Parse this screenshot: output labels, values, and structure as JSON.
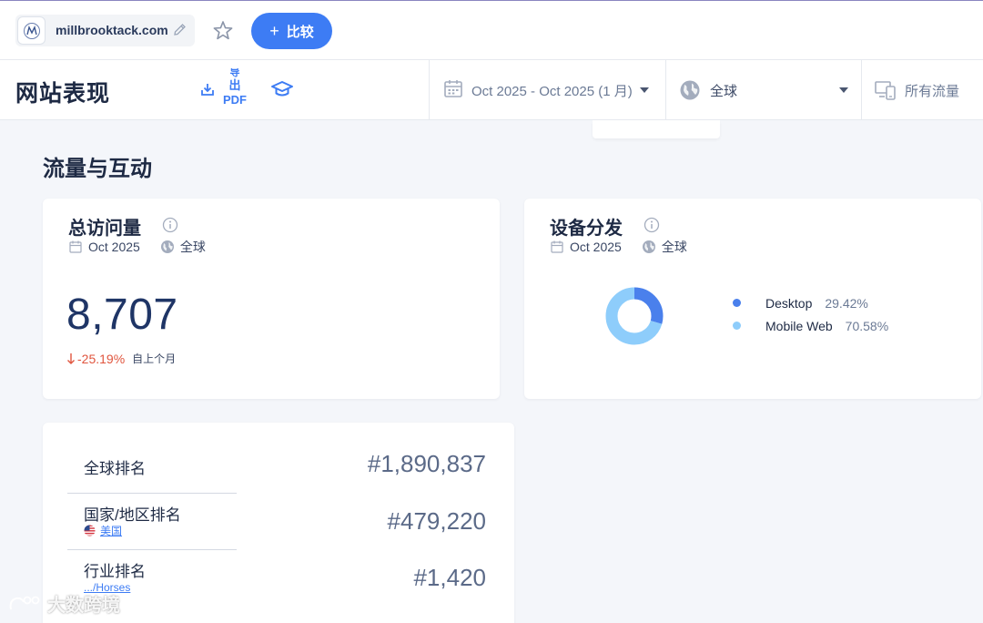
{
  "header": {
    "site_name": "millbrooktack.com",
    "compare_label": "比较",
    "compare_icon": "plus-icon"
  },
  "toolbar": {
    "page_title": "网站表现",
    "export_line1": "导",
    "export_line2": "出",
    "export_line3": "PDF",
    "date_range": "Oct 2025 - Oct 2025 (1 月)",
    "region": "全球",
    "traffic_type": "所有流量"
  },
  "section": {
    "title": "流量与互动"
  },
  "visits_card": {
    "title": "总访问量",
    "period": "Oct 2025",
    "region": "全球",
    "value": "8,707",
    "change": "-25.19%",
    "change_label": "自上个月",
    "change_color": "#e0553e"
  },
  "device_card": {
    "title": "设备分发",
    "period": "Oct 2025",
    "region": "全球",
    "segments": [
      {
        "label": "Desktop",
        "value": "29.42%",
        "fraction": 0.2942,
        "color": "#4a80ec"
      },
      {
        "label": "Mobile Web",
        "value": "70.58%",
        "fraction": 0.7058,
        "color": "#8ecdfb"
      }
    ]
  },
  "rank_card": {
    "global_label": "全球排名",
    "global_value": "#1,890,837",
    "country_label": "国家/地区排名",
    "country_name": "美国",
    "country_value": "#479,220",
    "industry_label": "行业排名",
    "industry_name": ".../Horses",
    "industry_value": "#1,420"
  },
  "watermark": {
    "text": "大数跨境"
  },
  "colors": {
    "accent": "#3d7cf4",
    "page_bg": "#f4f6fa",
    "negative": "#e0553e"
  }
}
